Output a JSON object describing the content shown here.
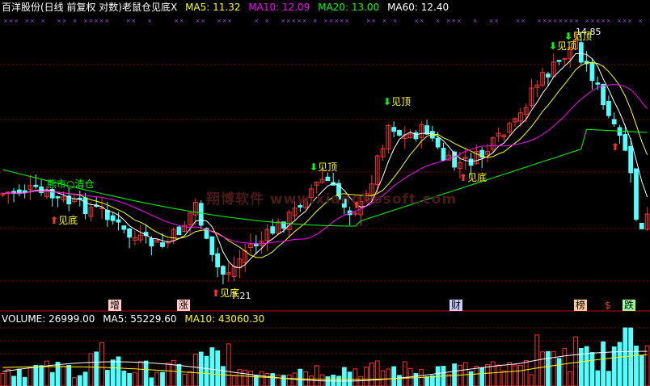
{
  "header": {
    "stock_name": "百洋股份(日线 前复权 对数)",
    "indicator_name": "老鼠仓见底X",
    "ma5": "MA5: 11.32",
    "ma10": "MA10: 12.09",
    "ma20": "MA20: 13.00",
    "ma60": "MA60: 12.40"
  },
  "volume_header": {
    "volume": "VOLUME: 26999.00",
    "ma5": "MA5: 55229.60",
    "ma10": "MA10: 43060.30"
  },
  "watermark": "翔博软件 www.xiangbosoft.com",
  "annotations": {
    "bear_market": "熊市○清仓",
    "high_price": "14.85",
    "low_price": "7.21"
  },
  "signals": {
    "top_label": "见顶",
    "bottom_label": "见底"
  },
  "event_markers": [
    "增",
    "涨",
    "财",
    "榜",
    "$",
    "跌"
  ],
  "colors": {
    "up": "#ff3232",
    "down": "#54ffff",
    "ma5": "#ffffff",
    "ma10": "#ffff00",
    "ma20": "#ff00ff",
    "ma60": "#00ff00",
    "grid": "#8b0000"
  },
  "chart_data": {
    "type": "candlestick",
    "price_range": [
      7.0,
      15.5
    ],
    "marked_high": 14.85,
    "marked_low": 7.21,
    "ma_latest": {
      "MA5": 11.32,
      "MA10": 12.09,
      "MA20": 13.0,
      "MA60": 12.4
    },
    "volume_latest": {
      "VOLUME": 26999.0,
      "MA5": 55229.6,
      "MA10": 43060.3
    }
  }
}
